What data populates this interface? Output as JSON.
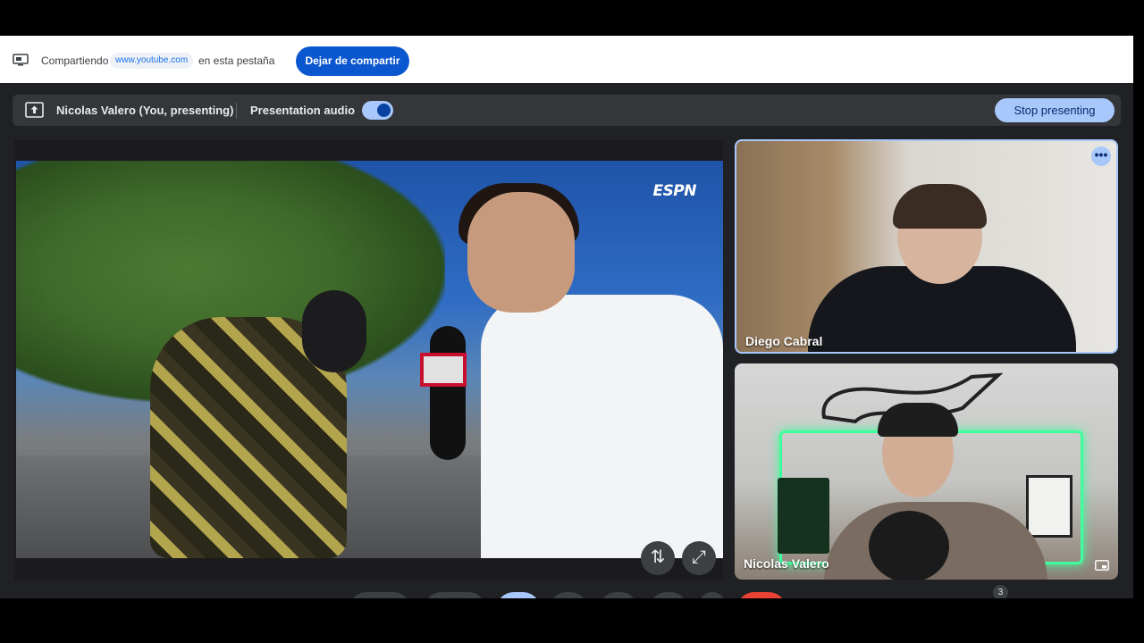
{
  "share_bar": {
    "prefix": "Compartiendo",
    "url": "www.youtube.com",
    "suffix": "en esta pestaña",
    "stop_label": "Dejar de compartir"
  },
  "present_bar": {
    "presenter": "Nicolas Valero (You, presenting)",
    "audio_label": "Presentation audio",
    "audio_enabled": true,
    "stop_label": "Stop presenting"
  },
  "presentation": {
    "broadcaster_logo": "ESPN",
    "controls": [
      {
        "icon": "swap-vert-icon",
        "glyph": "⇅"
      },
      {
        "icon": "fullscreen-icon",
        "glyph": "⤢"
      }
    ]
  },
  "participants": [
    {
      "name": "Diego Cabral",
      "menu_glyph": "•••"
    },
    {
      "name": "Nicolas Valero"
    }
  ],
  "controls_bar": {
    "badge_count": "3"
  },
  "colors": {
    "accent": "#0b57d0",
    "light_accent": "#a8c7fa",
    "meet_bg": "#202124",
    "end_call": "#ea4335"
  }
}
